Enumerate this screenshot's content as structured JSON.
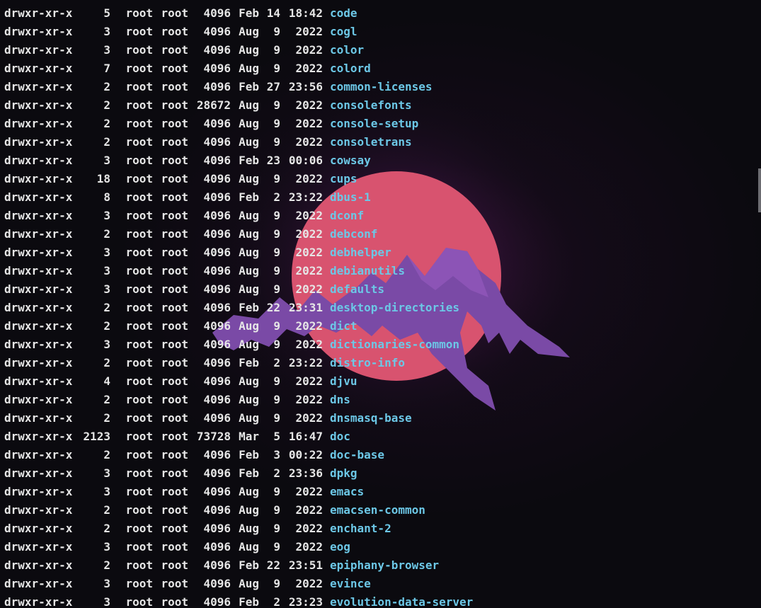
{
  "window": {
    "title": ""
  },
  "colors": {
    "background": "#0b0a0f",
    "text": "#e6e6e6",
    "directory": "#6cc7e6",
    "sun": "#d8536f",
    "mountain": "#7a4aa6"
  },
  "wallpaper": {
    "icon": "mountain-sun-logo"
  },
  "entries": [
    {
      "perms": "drwxr-xr-x",
      "links": "5",
      "owner": "root",
      "group": "root",
      "size": "4096",
      "month": "Feb",
      "day": "14",
      "time": "18:42",
      "name": "code"
    },
    {
      "perms": "drwxr-xr-x",
      "links": "3",
      "owner": "root",
      "group": "root",
      "size": "4096",
      "month": "Aug",
      "day": "9",
      "time": "2022",
      "name": "cogl"
    },
    {
      "perms": "drwxr-xr-x",
      "links": "3",
      "owner": "root",
      "group": "root",
      "size": "4096",
      "month": "Aug",
      "day": "9",
      "time": "2022",
      "name": "color"
    },
    {
      "perms": "drwxr-xr-x",
      "links": "7",
      "owner": "root",
      "group": "root",
      "size": "4096",
      "month": "Aug",
      "day": "9",
      "time": "2022",
      "name": "colord"
    },
    {
      "perms": "drwxr-xr-x",
      "links": "2",
      "owner": "root",
      "group": "root",
      "size": "4096",
      "month": "Feb",
      "day": "27",
      "time": "23:56",
      "name": "common-licenses"
    },
    {
      "perms": "drwxr-xr-x",
      "links": "2",
      "owner": "root",
      "group": "root",
      "size": "28672",
      "month": "Aug",
      "day": "9",
      "time": "2022",
      "name": "consolefonts"
    },
    {
      "perms": "drwxr-xr-x",
      "links": "2",
      "owner": "root",
      "group": "root",
      "size": "4096",
      "month": "Aug",
      "day": "9",
      "time": "2022",
      "name": "console-setup"
    },
    {
      "perms": "drwxr-xr-x",
      "links": "2",
      "owner": "root",
      "group": "root",
      "size": "4096",
      "month": "Aug",
      "day": "9",
      "time": "2022",
      "name": "consoletrans"
    },
    {
      "perms": "drwxr-xr-x",
      "links": "3",
      "owner": "root",
      "group": "root",
      "size": "4096",
      "month": "Feb",
      "day": "23",
      "time": "00:06",
      "name": "cowsay"
    },
    {
      "perms": "drwxr-xr-x",
      "links": "18",
      "owner": "root",
      "group": "root",
      "size": "4096",
      "month": "Aug",
      "day": "9",
      "time": "2022",
      "name": "cups"
    },
    {
      "perms": "drwxr-xr-x",
      "links": "8",
      "owner": "root",
      "group": "root",
      "size": "4096",
      "month": "Feb",
      "day": "2",
      "time": "23:22",
      "name": "dbus-1"
    },
    {
      "perms": "drwxr-xr-x",
      "links": "3",
      "owner": "root",
      "group": "root",
      "size": "4096",
      "month": "Aug",
      "day": "9",
      "time": "2022",
      "name": "dconf"
    },
    {
      "perms": "drwxr-xr-x",
      "links": "2",
      "owner": "root",
      "group": "root",
      "size": "4096",
      "month": "Aug",
      "day": "9",
      "time": "2022",
      "name": "debconf"
    },
    {
      "perms": "drwxr-xr-x",
      "links": "3",
      "owner": "root",
      "group": "root",
      "size": "4096",
      "month": "Aug",
      "day": "9",
      "time": "2022",
      "name": "debhelper"
    },
    {
      "perms": "drwxr-xr-x",
      "links": "3",
      "owner": "root",
      "group": "root",
      "size": "4096",
      "month": "Aug",
      "day": "9",
      "time": "2022",
      "name": "debianutils"
    },
    {
      "perms": "drwxr-xr-x",
      "links": "3",
      "owner": "root",
      "group": "root",
      "size": "4096",
      "month": "Aug",
      "day": "9",
      "time": "2022",
      "name": "defaults"
    },
    {
      "perms": "drwxr-xr-x",
      "links": "2",
      "owner": "root",
      "group": "root",
      "size": "4096",
      "month": "Feb",
      "day": "22",
      "time": "23:31",
      "name": "desktop-directories"
    },
    {
      "perms": "drwxr-xr-x",
      "links": "2",
      "owner": "root",
      "group": "root",
      "size": "4096",
      "month": "Aug",
      "day": "9",
      "time": "2022",
      "name": "dict"
    },
    {
      "perms": "drwxr-xr-x",
      "links": "3",
      "owner": "root",
      "group": "root",
      "size": "4096",
      "month": "Aug",
      "day": "9",
      "time": "2022",
      "name": "dictionaries-common"
    },
    {
      "perms": "drwxr-xr-x",
      "links": "2",
      "owner": "root",
      "group": "root",
      "size": "4096",
      "month": "Feb",
      "day": "2",
      "time": "23:22",
      "name": "distro-info"
    },
    {
      "perms": "drwxr-xr-x",
      "links": "4",
      "owner": "root",
      "group": "root",
      "size": "4096",
      "month": "Aug",
      "day": "9",
      "time": "2022",
      "name": "djvu"
    },
    {
      "perms": "drwxr-xr-x",
      "links": "2",
      "owner": "root",
      "group": "root",
      "size": "4096",
      "month": "Aug",
      "day": "9",
      "time": "2022",
      "name": "dns"
    },
    {
      "perms": "drwxr-xr-x",
      "links": "2",
      "owner": "root",
      "group": "root",
      "size": "4096",
      "month": "Aug",
      "day": "9",
      "time": "2022",
      "name": "dnsmasq-base"
    },
    {
      "perms": "drwxr-xr-x",
      "links": "2123",
      "owner": "root",
      "group": "root",
      "size": "73728",
      "month": "Mar",
      "day": "5",
      "time": "16:47",
      "name": "doc"
    },
    {
      "perms": "drwxr-xr-x",
      "links": "2",
      "owner": "root",
      "group": "root",
      "size": "4096",
      "month": "Feb",
      "day": "3",
      "time": "00:22",
      "name": "doc-base"
    },
    {
      "perms": "drwxr-xr-x",
      "links": "3",
      "owner": "root",
      "group": "root",
      "size": "4096",
      "month": "Feb",
      "day": "2",
      "time": "23:36",
      "name": "dpkg"
    },
    {
      "perms": "drwxr-xr-x",
      "links": "3",
      "owner": "root",
      "group": "root",
      "size": "4096",
      "month": "Aug",
      "day": "9",
      "time": "2022",
      "name": "emacs"
    },
    {
      "perms": "drwxr-xr-x",
      "links": "2",
      "owner": "root",
      "group": "root",
      "size": "4096",
      "month": "Aug",
      "day": "9",
      "time": "2022",
      "name": "emacsen-common"
    },
    {
      "perms": "drwxr-xr-x",
      "links": "2",
      "owner": "root",
      "group": "root",
      "size": "4096",
      "month": "Aug",
      "day": "9",
      "time": "2022",
      "name": "enchant-2"
    },
    {
      "perms": "drwxr-xr-x",
      "links": "3",
      "owner": "root",
      "group": "root",
      "size": "4096",
      "month": "Aug",
      "day": "9",
      "time": "2022",
      "name": "eog"
    },
    {
      "perms": "drwxr-xr-x",
      "links": "2",
      "owner": "root",
      "group": "root",
      "size": "4096",
      "month": "Feb",
      "day": "22",
      "time": "23:51",
      "name": "epiphany-browser"
    },
    {
      "perms": "drwxr-xr-x",
      "links": "3",
      "owner": "root",
      "group": "root",
      "size": "4096",
      "month": "Aug",
      "day": "9",
      "time": "2022",
      "name": "evince"
    },
    {
      "perms": "drwxr-xr-x",
      "links": "3",
      "owner": "root",
      "group": "root",
      "size": "4096",
      "month": "Feb",
      "day": "2",
      "time": "23:23",
      "name": "evolution-data-server"
    }
  ]
}
